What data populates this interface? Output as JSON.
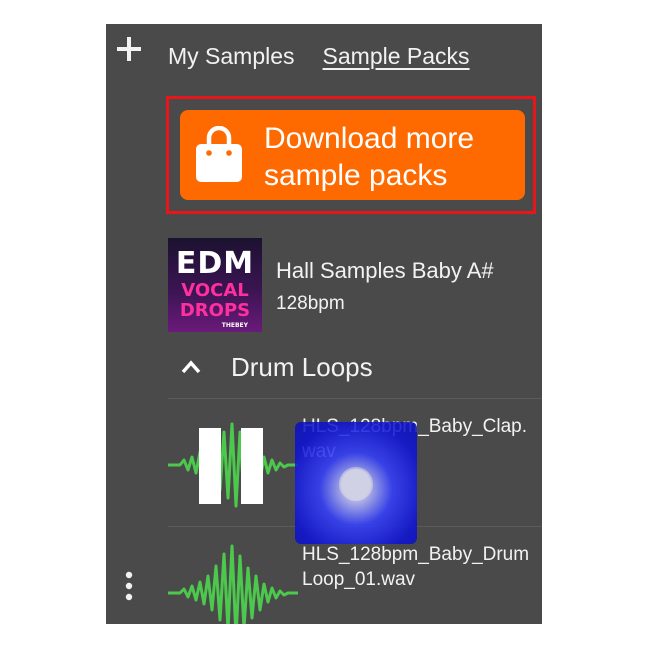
{
  "tabs": {
    "my_samples": "My Samples",
    "sample_packs": "Sample Packs",
    "active": "Sample Packs"
  },
  "download_button": {
    "line1": "Download more",
    "line2": "sample packs",
    "icon": "shopping-bag-icon",
    "color": "#ff6a00"
  },
  "highlight_color": "#e8161a",
  "pack": {
    "cover_text": [
      "EDM",
      "VOCAL",
      "DROPS",
      "THEBEY"
    ],
    "title": "Hall Samples Baby A#",
    "bpm": "128bpm"
  },
  "section": {
    "label": "Drum Loops",
    "icon": "chevron-up-icon"
  },
  "samples": [
    {
      "name": "HLS_128bpm_Baby_Clap.wav",
      "playing": true
    },
    {
      "name": "HLS_128bpm_Baby_DrumLoop_01.wav",
      "playing": false
    }
  ],
  "waveform_color": "#4cc94c",
  "icons": {
    "add": "plus-icon",
    "more": "more-vertical-icon",
    "pause": "pause-icon"
  }
}
